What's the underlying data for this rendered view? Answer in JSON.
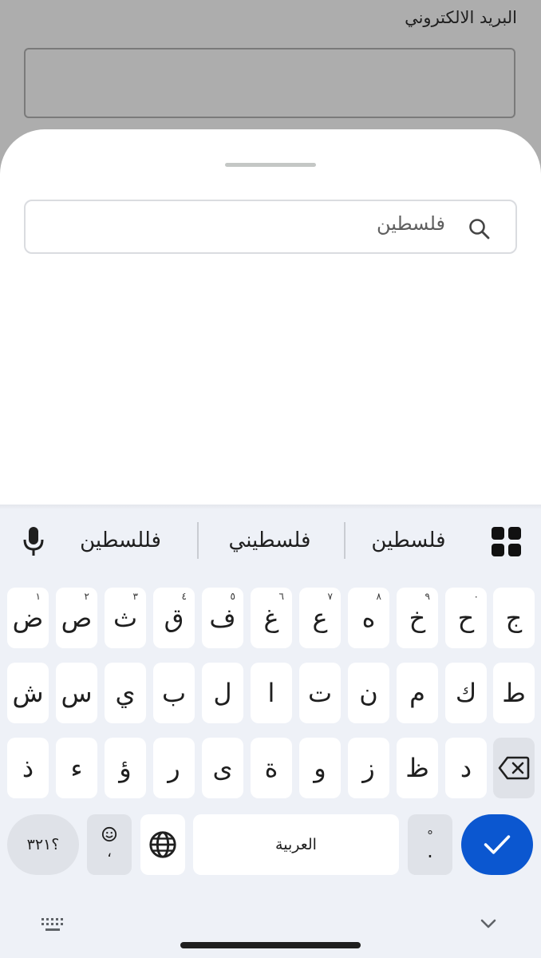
{
  "form": {
    "email_label": "البريد الالكتروني",
    "email_value": ""
  },
  "sheet": {
    "search_value": "فلسطين",
    "search_icon": "search-icon"
  },
  "keyboard": {
    "suggestions": [
      "فلسطين",
      "فلسطيني",
      "فللسطين"
    ],
    "row1": [
      {
        "label": "ض",
        "hint": "١"
      },
      {
        "label": "ص",
        "hint": "٢"
      },
      {
        "label": "ث",
        "hint": "٣"
      },
      {
        "label": "ق",
        "hint": "٤"
      },
      {
        "label": "ف",
        "hint": "٥"
      },
      {
        "label": "غ",
        "hint": "٦"
      },
      {
        "label": "ع",
        "hint": "٧"
      },
      {
        "label": "ه",
        "hint": "٨"
      },
      {
        "label": "خ",
        "hint": "٩"
      },
      {
        "label": "ح",
        "hint": "٠"
      },
      {
        "label": "ج",
        "hint": ""
      }
    ],
    "row2": [
      "ش",
      "س",
      "ي",
      "ب",
      "ل",
      "ا",
      "ت",
      "ن",
      "م",
      "ك",
      "ط"
    ],
    "row3": [
      "ذ",
      "ء",
      "ؤ",
      "ر",
      "ى",
      "ة",
      "و",
      "ز",
      "ظ",
      "د"
    ],
    "symbols_label": "؟٣٢١",
    "emoji_comma_label": "،",
    "space_label": "العربية",
    "period_label": ".",
    "period_hint": "°",
    "accent_color": "#0b57d0"
  }
}
